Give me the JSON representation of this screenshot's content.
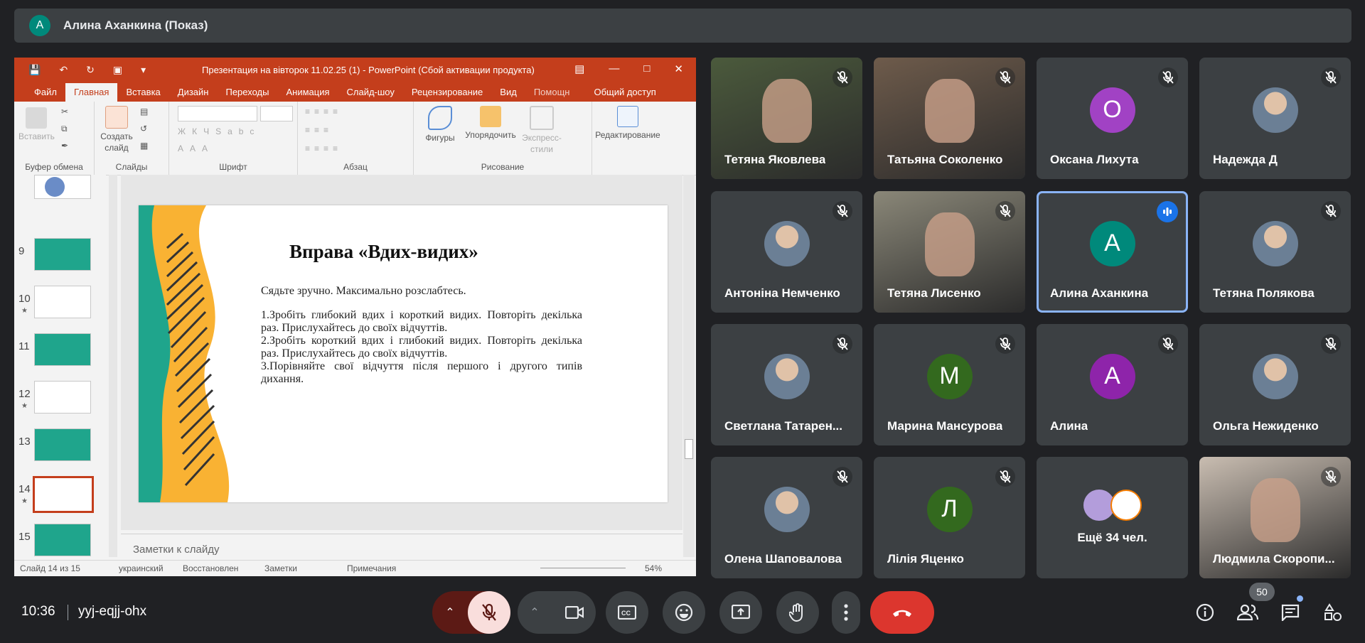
{
  "presenter": {
    "initial": "А",
    "label": "Алина Аханкина (Показ)"
  },
  "powerpoint": {
    "doc_title": "Презентация на вівторок 11.02.25 (1) - PowerPoint (Сбой активации продукта)",
    "tabs": [
      "Файл",
      "Главная",
      "Вставка",
      "Дизайн",
      "Переходы",
      "Анимация",
      "Слайд-шоу",
      "Рецензирование",
      "Вид",
      "Помощн"
    ],
    "share": "Общий доступ",
    "ribbon": {
      "paste": "Вставить",
      "new_slide": "Создать слайд",
      "shapes": "Фигуры",
      "arrange": "Упорядочить",
      "express_styles": "Экспресс-стили",
      "editing": "Редактирование",
      "group_clipboard": "Буфер обмена",
      "group_slides": "Слайды",
      "group_font": "Шрифт",
      "group_paragraph": "Абзац",
      "group_drawing": "Рисование"
    },
    "thumbnails": [
      {
        "num": "9",
        "star": ""
      },
      {
        "num": "10",
        "star": "★"
      },
      {
        "num": "11",
        "star": ""
      },
      {
        "num": "12",
        "star": "★"
      },
      {
        "num": "13",
        "star": ""
      },
      {
        "num": "14",
        "star": "★"
      },
      {
        "num": "15",
        "star": ""
      }
    ],
    "slide": {
      "title": "Вправа «Вдих-видих»",
      "intro": "Сядьте зручно. Максимально розслабтесь.",
      "steps": [
        "1.Зробіть глибокий вдих і короткий видих. Повторіть декілька раз. Прислухайтесь до своїх відчуттів.",
        "2.Зробіть короткий вдих і глибокий видих. Повторіть декілька раз. Прислухайтесь до своїх відчуттів.",
        "3.Порівняйте свої відчуття після першого і другого типів дихання."
      ]
    },
    "notes_placeholder": "Заметки к слайду",
    "status": {
      "slide_of": "Слайд 14 из 15",
      "language": "украинский",
      "recovered": "Восстановлен",
      "notes": "Заметки",
      "comments": "Примечания",
      "zoom": "54%"
    }
  },
  "participants": [
    {
      "name": "Тетяна Яковлева",
      "type": "video"
    },
    {
      "name": "Татьяна Соколенко",
      "type": "video"
    },
    {
      "name": "Оксана Лихута",
      "type": "initial",
      "initial": "О",
      "color": "#a142c4"
    },
    {
      "name": "Надежда Д",
      "type": "photo"
    },
    {
      "name": "Антоніна Немченко",
      "type": "photo"
    },
    {
      "name": "Тетяна Лисенко",
      "type": "video"
    },
    {
      "name": "Алина Аханкина",
      "type": "initial",
      "initial": "А",
      "color": "#00897b"
    },
    {
      "name": "Тетяна Полякова",
      "type": "photo"
    },
    {
      "name": "Светлана Татарен...",
      "type": "photo"
    },
    {
      "name": "Марина Мансурова",
      "type": "initial",
      "initial": "М",
      "color": "#33691e"
    },
    {
      "name": "Алина",
      "type": "initial",
      "initial": "А",
      "color": "#8e24aa"
    },
    {
      "name": "Ольга Нежиденко",
      "type": "photo"
    },
    {
      "name": "Олена Шаповалова",
      "type": "photo"
    },
    {
      "name": "Лілія Яценко",
      "type": "initial",
      "initial": "Л",
      "color": "#33691e"
    },
    {
      "name": "Ещё 34 чел.",
      "type": "more"
    },
    {
      "name": "Людмила Скоропи...",
      "type": "video"
    }
  ],
  "meeting": {
    "time": "10:36",
    "code": "yyj-eqjj-ohx",
    "participant_count": "50"
  }
}
